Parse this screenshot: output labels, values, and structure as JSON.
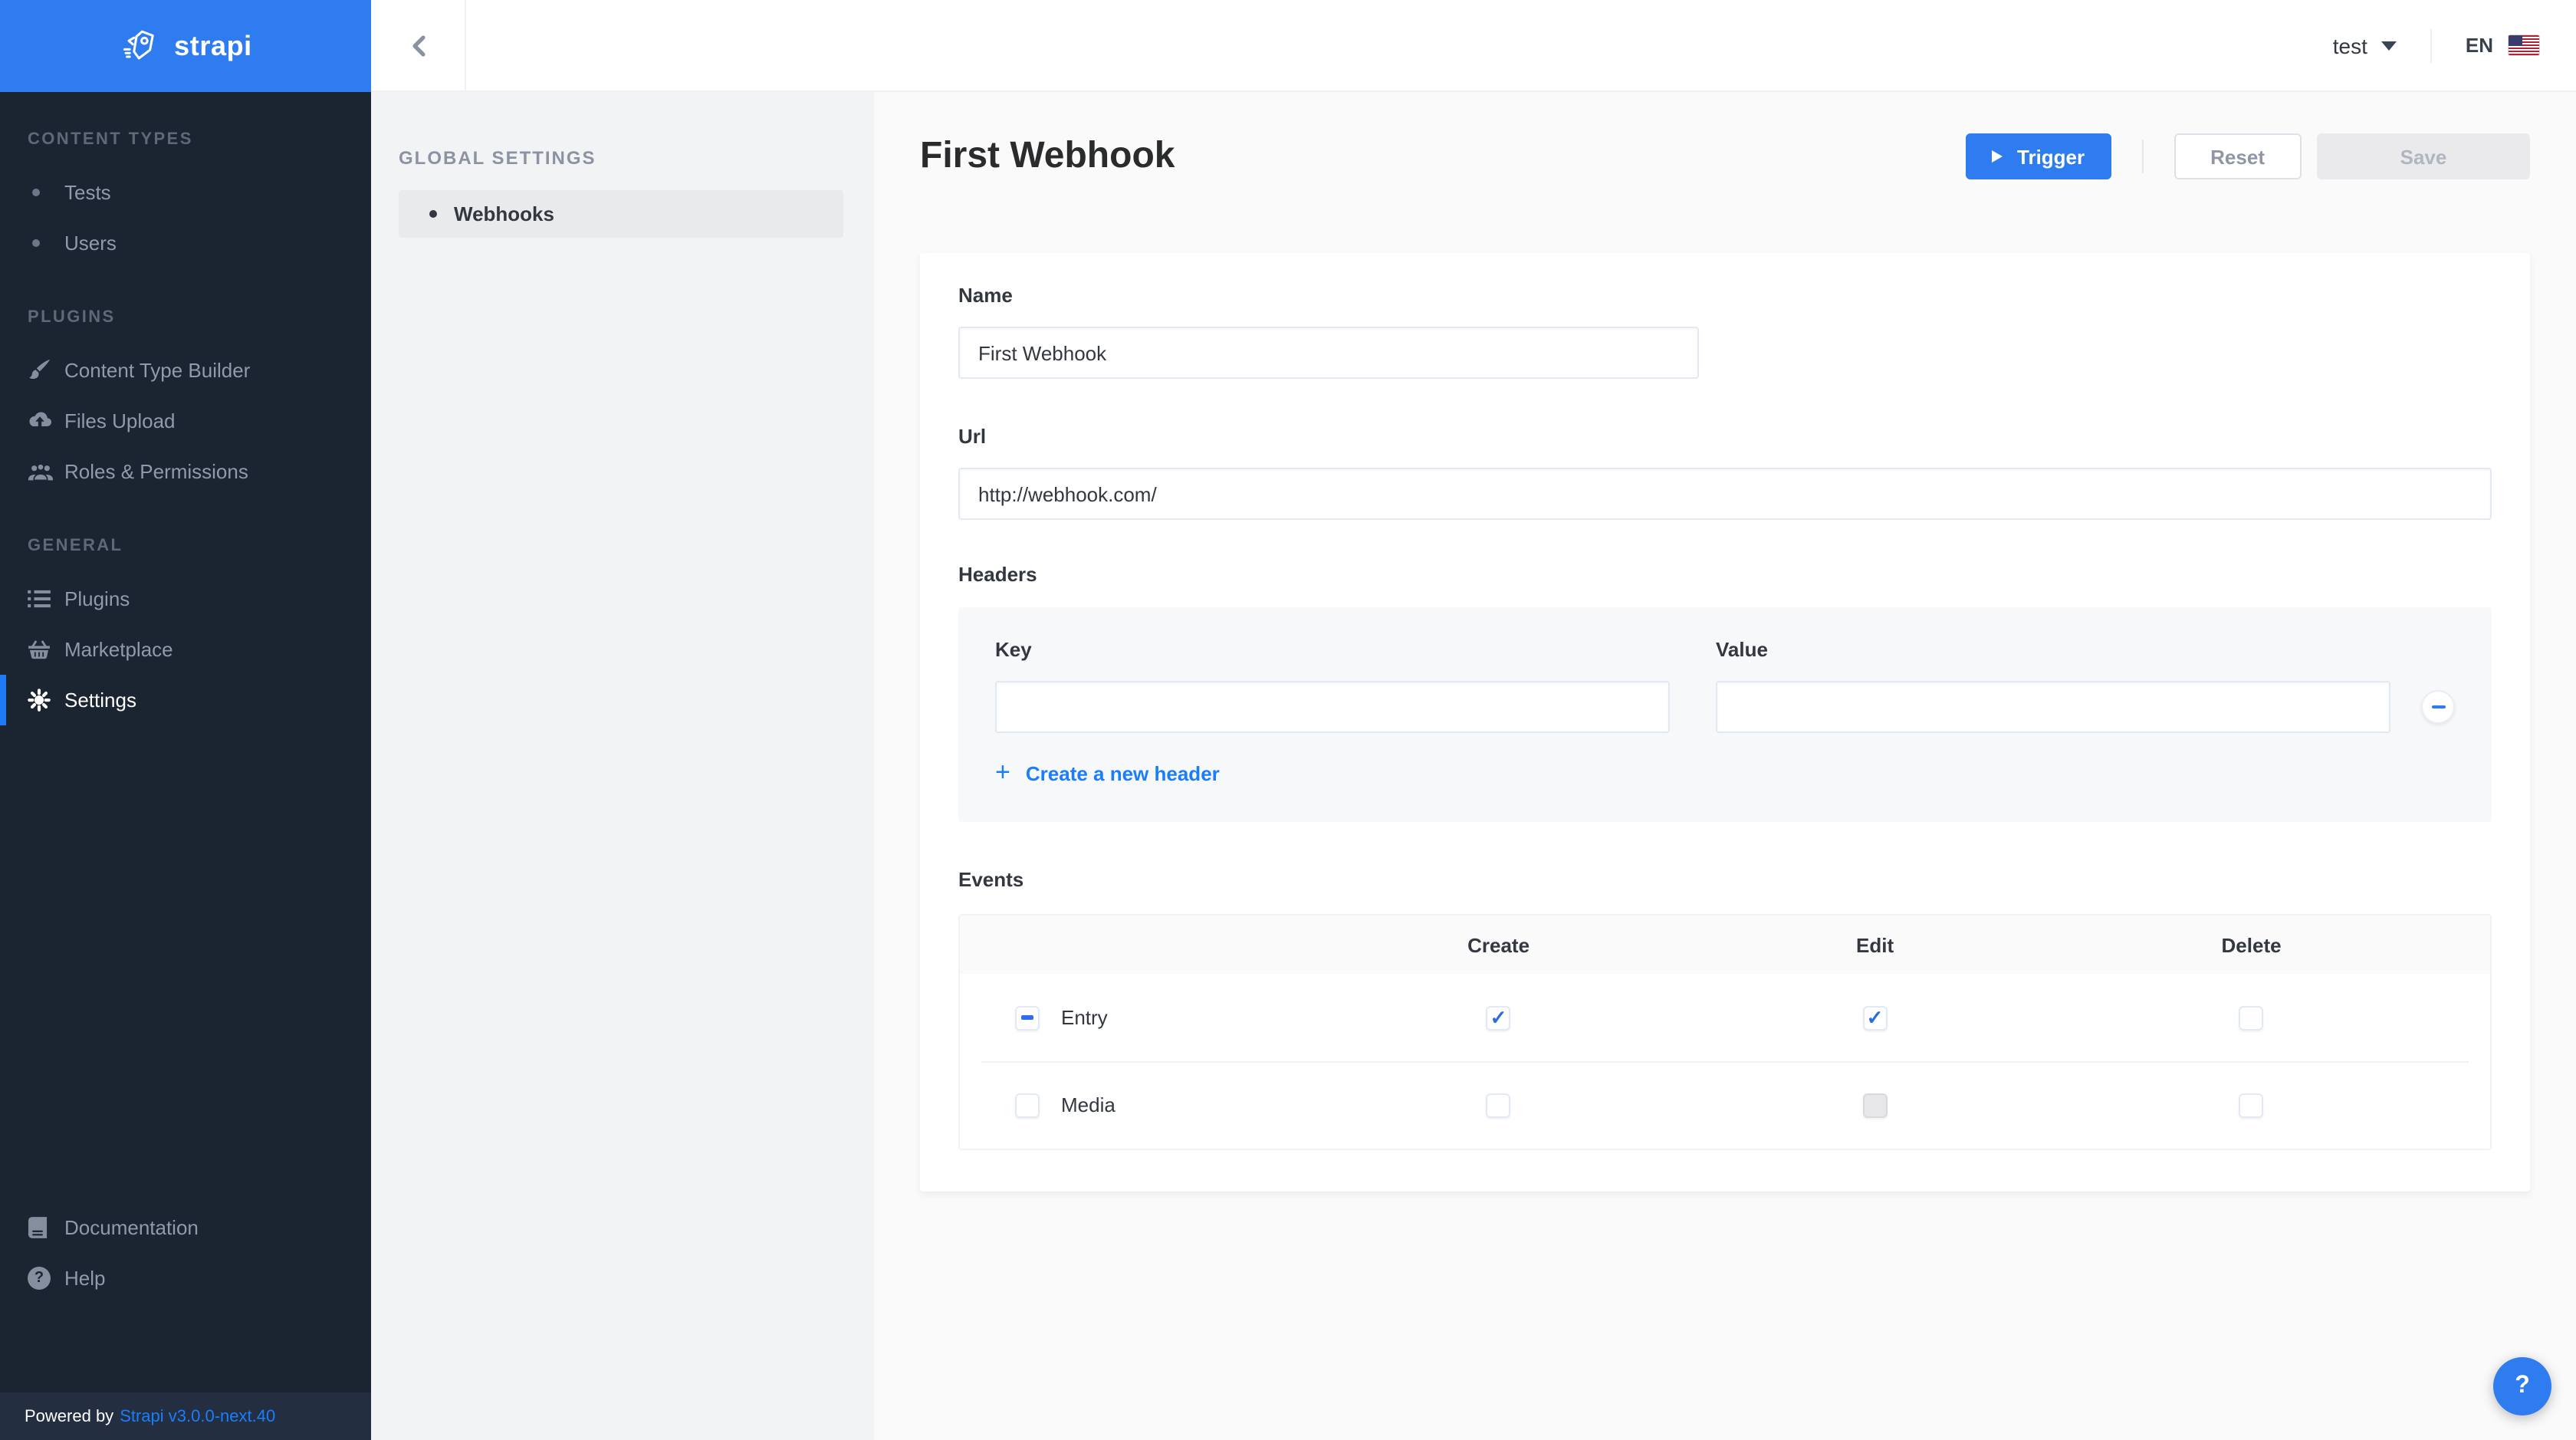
{
  "brand": {
    "logo_text": "strapi"
  },
  "topbar": {
    "user_name": "test",
    "locale": "EN"
  },
  "sidebar": {
    "sections": [
      {
        "title": "CONTENT TYPES",
        "items": [
          {
            "label": "Tests"
          },
          {
            "label": "Users"
          }
        ]
      },
      {
        "title": "PLUGINS",
        "items": [
          {
            "label": "Content Type Builder"
          },
          {
            "label": "Files Upload"
          },
          {
            "label": "Roles & Permissions"
          }
        ]
      },
      {
        "title": "GENERAL",
        "items": [
          {
            "label": "Plugins"
          },
          {
            "label": "Marketplace"
          },
          {
            "label": "Settings"
          }
        ]
      }
    ],
    "bottom_items": [
      {
        "label": "Documentation"
      },
      {
        "label": "Help"
      }
    ],
    "powered_by": "Powered by",
    "version_link": "Strapi v3.0.0-next.40"
  },
  "settings_panel": {
    "title": "GLOBAL SETTINGS",
    "items": [
      {
        "label": "Webhooks"
      }
    ]
  },
  "page": {
    "title": "First Webhook",
    "trigger_label": "Trigger",
    "reset_label": "Reset",
    "save_label": "Save"
  },
  "form": {
    "name": {
      "label": "Name",
      "value": "First Webhook"
    },
    "url": {
      "label": "Url",
      "value": "http://webhook.com/"
    },
    "headers": {
      "label": "Headers",
      "key_label": "Key",
      "key_value": "",
      "value_label": "Value",
      "value_value": "",
      "add_label": "Create a new header"
    },
    "events": {
      "label": "Events",
      "columns": [
        "Create",
        "Edit",
        "Delete"
      ],
      "rows": [
        {
          "name": "Entry",
          "row_state": "indeterminate",
          "create": "checked",
          "edit": "checked",
          "delete": "unchecked"
        },
        {
          "name": "Media",
          "row_state": "unchecked",
          "create": "unchecked",
          "edit": "disabled",
          "delete": "unchecked"
        }
      ]
    }
  },
  "help_button": {
    "label": "?"
  },
  "colors": {
    "accent_blue": "#2f7cf0",
    "link_blue": "#1c7dfa",
    "sidebar_bg": "#1b2431",
    "active_bar": "#1f7af8"
  }
}
